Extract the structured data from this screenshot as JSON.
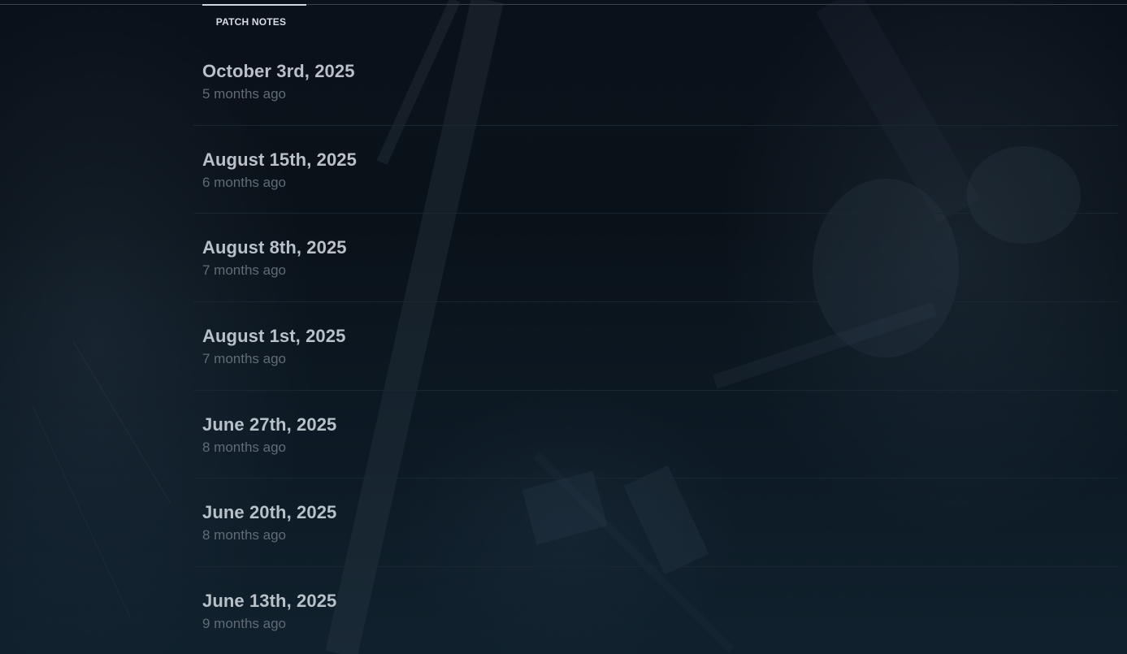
{
  "tabs": {
    "active_label": "PATCH NOTES"
  },
  "patch_notes": [
    {
      "date": "October 3rd, 2025",
      "relative": "5 months ago"
    },
    {
      "date": "August 15th, 2025",
      "relative": "6 months ago"
    },
    {
      "date": "August 8th, 2025",
      "relative": "7 months ago"
    },
    {
      "date": "August 1st, 2025",
      "relative": "7 months ago"
    },
    {
      "date": "June 27th, 2025",
      "relative": "8 months ago"
    },
    {
      "date": "June 20th, 2025",
      "relative": "8 months ago"
    },
    {
      "date": "June 13th, 2025",
      "relative": "9 months ago"
    }
  ],
  "colors": {
    "background": "#0a1219",
    "title_text": "#b8c0c8",
    "subtitle_text": "#616b75",
    "divider": "#1c2631",
    "tab_indicator": "#cfd6de"
  }
}
